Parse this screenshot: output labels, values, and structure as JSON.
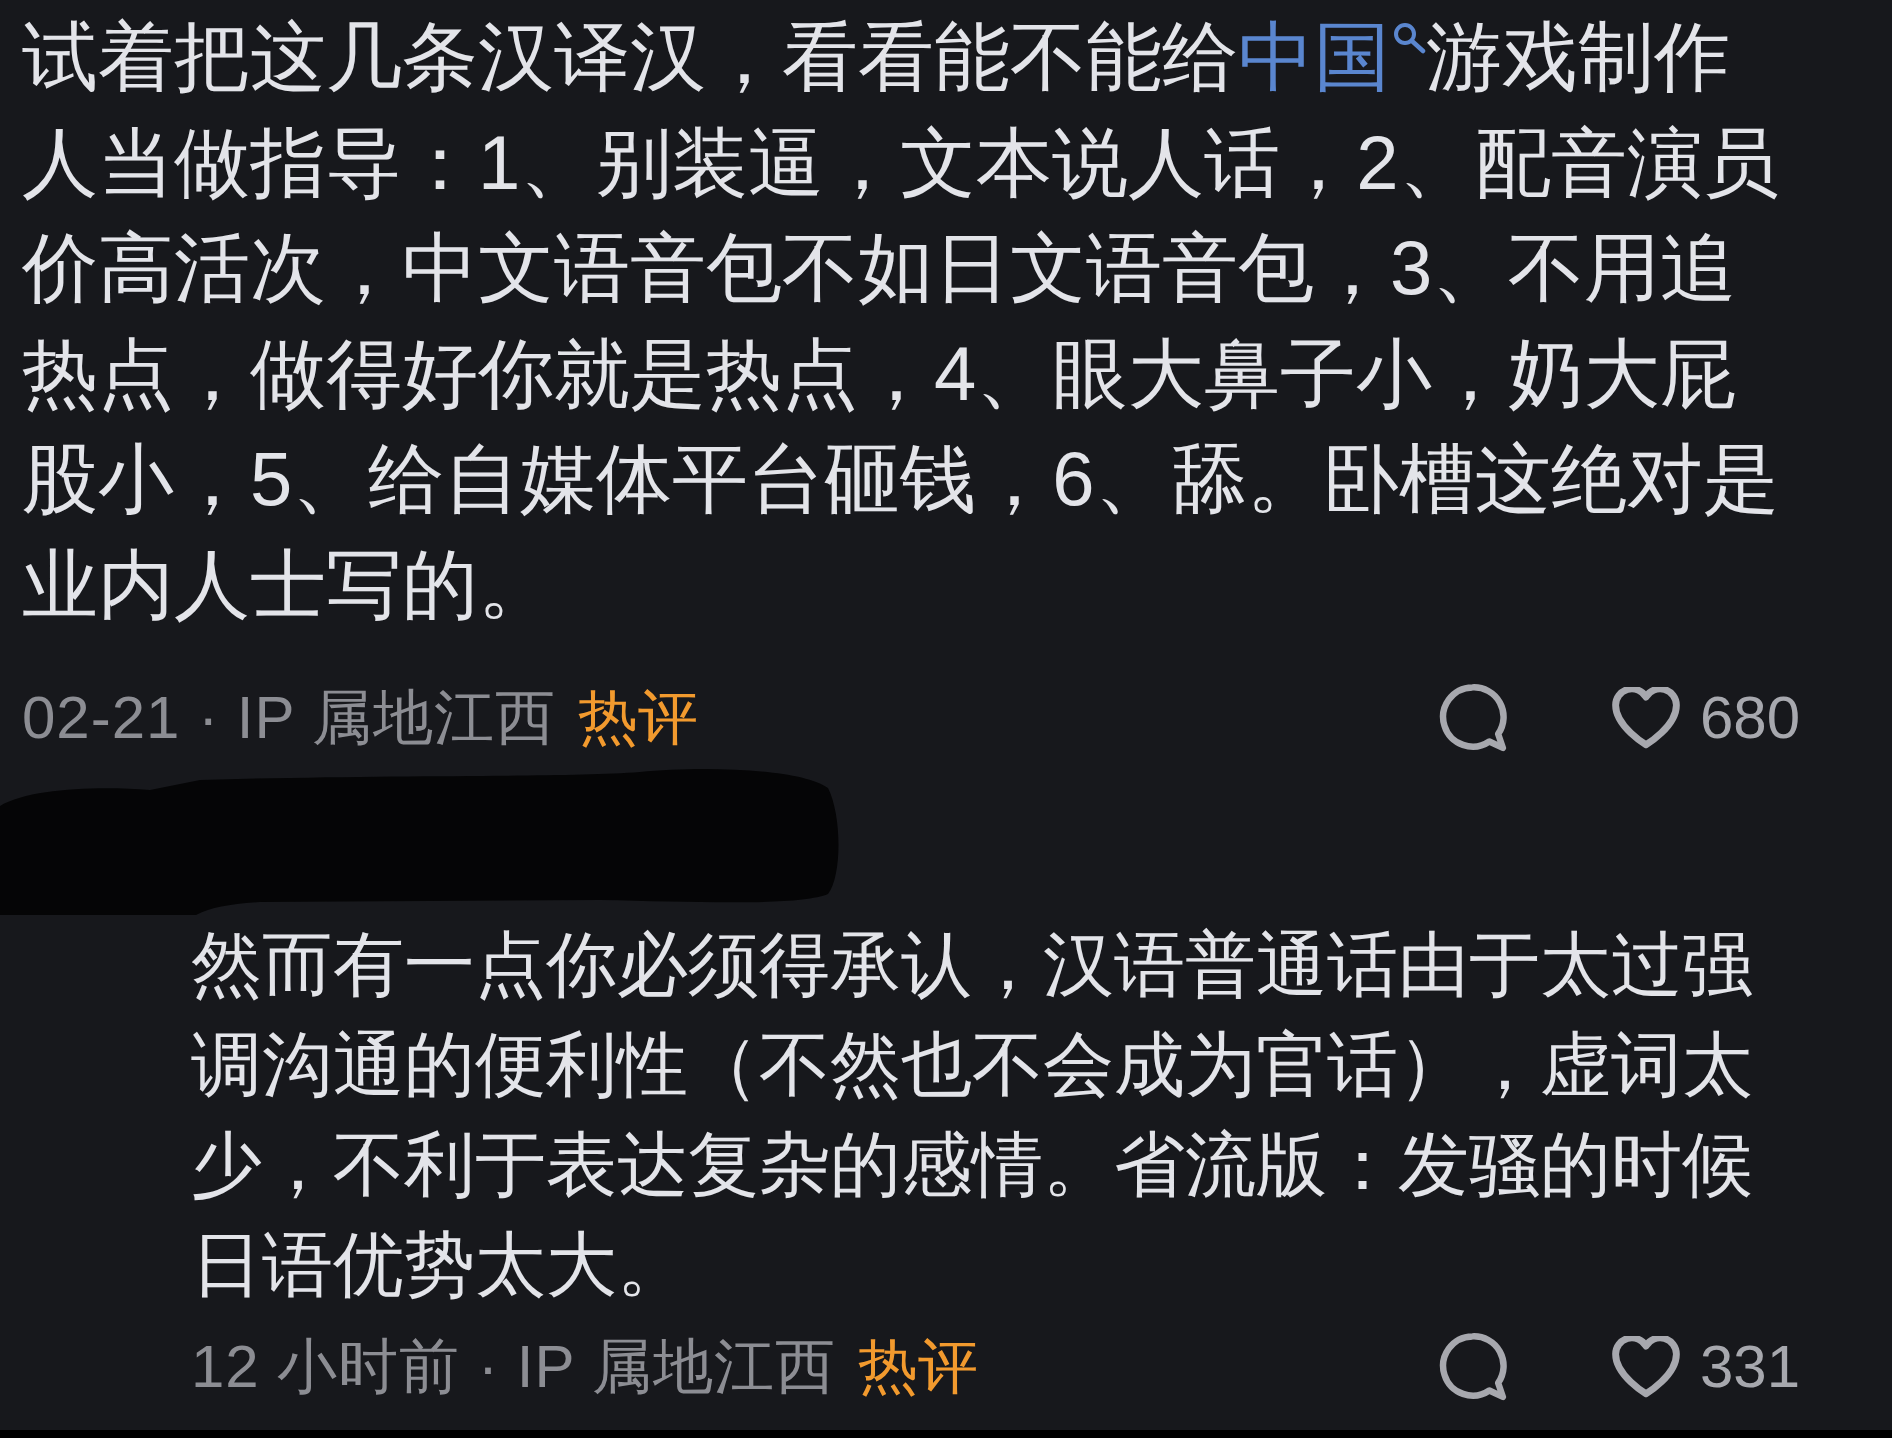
{
  "comments": [
    {
      "kind": "comment",
      "body_lines": [
        [
          {
            "kind": "text",
            "text": "试着把这几条汉译汉，看看能不能给"
          },
          {
            "kind": "link",
            "text": "中国"
          },
          {
            "kind": "text",
            "text": "游戏制作"
          }
        ],
        [
          {
            "kind": "text",
            "text": "人当做指导：1、别装逼，文本说人话，2、配音演员"
          }
        ],
        [
          {
            "kind": "text",
            "text": "价高活次，中文语音包不如日文语音包，3、不用追"
          }
        ],
        [
          {
            "kind": "text",
            "text": "热点，做得好你就是热点，4、眼大鼻子小，奶大屁"
          }
        ],
        [
          {
            "kind": "text",
            "text": "股小，5、给自媒体平台砸钱，6、舔。卧槽这绝对是"
          }
        ],
        [
          {
            "kind": "text",
            "text": "业内人士写的。"
          }
        ]
      ],
      "info": "02-21 · IP 属地江西",
      "badge": "热评",
      "like_count": "680"
    },
    {
      "kind": "reply",
      "author": {
        "redacted": true
      },
      "body_lines": [
        [
          {
            "kind": "text",
            "text": "然而有一点你必须得承认，汉语普通话由于太过强"
          }
        ],
        [
          {
            "kind": "text",
            "text": "调沟通的便利性（不然也不会成为官话），虚词太"
          }
        ],
        [
          {
            "kind": "text",
            "text": "少，不利于表达复杂的感情。省流版：发骚的时候"
          }
        ],
        [
          {
            "kind": "text",
            "text": "日语优势太大。"
          }
        ]
      ],
      "info": "12 小时前 · IP 属地江西",
      "badge": "热评",
      "like_count": "331"
    }
  ]
}
